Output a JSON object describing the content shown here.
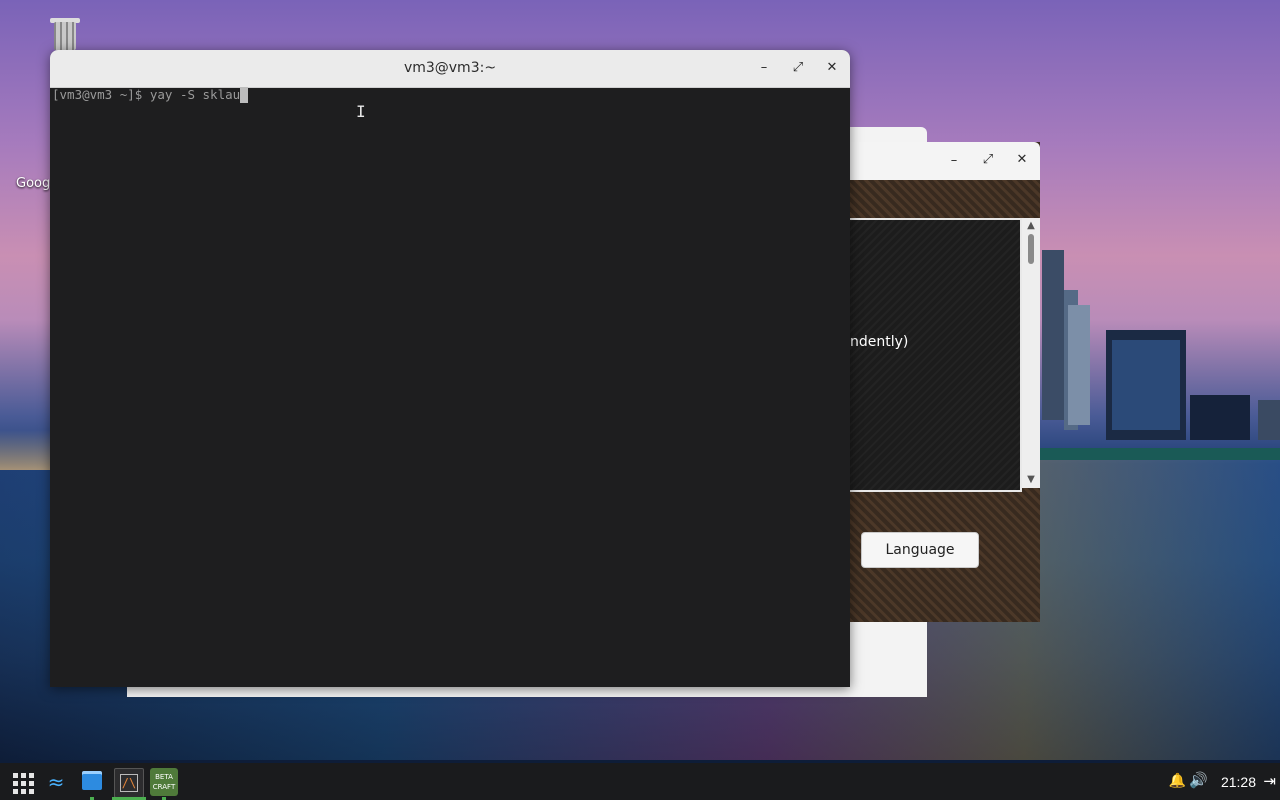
{
  "desktop": {
    "trash_label": "",
    "partial_icon_label": "Goog"
  },
  "terminal": {
    "title": "vm3@vm3:~",
    "prompt": "[vm3@vm3 ~]$ ",
    "command": "yay -S sklau",
    "minimize_glyph": "–",
    "maximize_glyph": "⤢",
    "close_glyph": "✕"
  },
  "game_window": {
    "minimize_glyph": "–",
    "maximize_glyph": "⤢",
    "close_glyph": "✕",
    "partial_text": "ndently)",
    "language_button": "Language",
    "scroll_up_glyph": "▲",
    "scroll_down_glyph": "▼"
  },
  "taskbar": {
    "apps_icon": "apps-grid-icon",
    "dolphin_icon": "dolphin-icon",
    "files_icon": "files-icon",
    "konsole_icon": "konsole-icon",
    "konsole_glyph": "/\\",
    "betacraft_label_top": "BETA",
    "betacraft_label_bottom": "CRAFT",
    "bell_glyph": "🔔",
    "volume_glyph": "🔊",
    "clock": "21:28",
    "exit_glyph": "⇥"
  },
  "colors": {
    "terminal_bg": "#1e1e1f",
    "taskbar_bg": "#1a1b1d",
    "active_indicator": "#4caf50"
  }
}
